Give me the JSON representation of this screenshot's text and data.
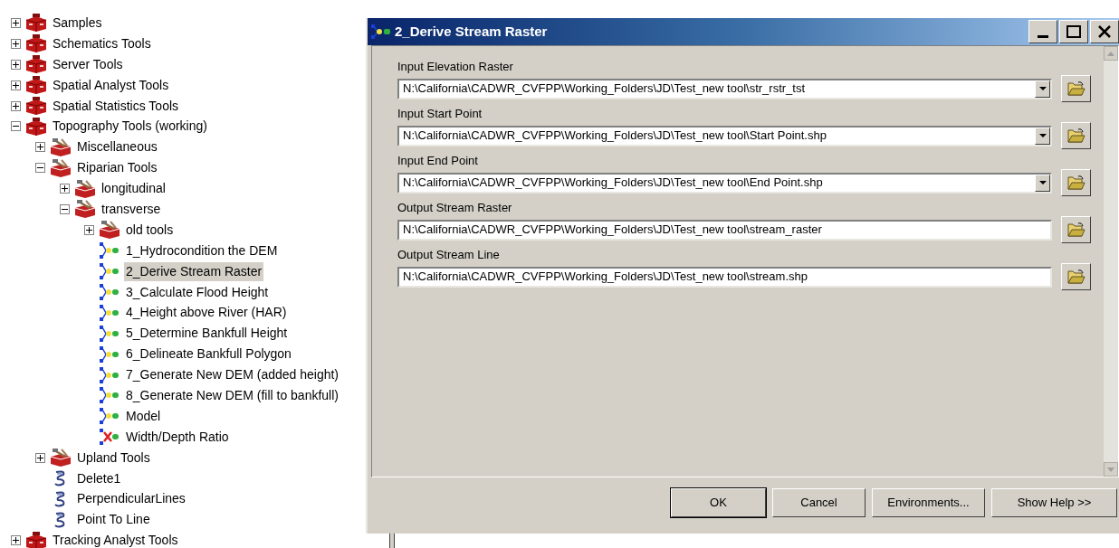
{
  "tree": [
    {
      "label": "Samples",
      "kind": "toolbox",
      "expanded": false,
      "selected": false
    },
    {
      "label": "Schematics Tools",
      "kind": "toolbox",
      "expanded": false,
      "selected": false
    },
    {
      "label": "Server Tools",
      "kind": "toolbox",
      "expanded": false,
      "selected": false
    },
    {
      "label": "Spatial Analyst Tools",
      "kind": "toolbox",
      "expanded": false,
      "selected": false
    },
    {
      "label": "Spatial Statistics Tools",
      "kind": "toolbox",
      "expanded": false,
      "selected": false
    },
    {
      "label": "Topography Tools (working)",
      "kind": "toolbox",
      "expanded": true,
      "selected": false,
      "children": [
        {
          "label": "Miscellaneous",
          "kind": "toolset",
          "expanded": false,
          "selected": false
        },
        {
          "label": "Riparian Tools",
          "kind": "toolset",
          "expanded": true,
          "selected": false,
          "children": [
            {
              "label": "longitudinal",
              "kind": "toolset",
              "expanded": false,
              "selected": false
            },
            {
              "label": "transverse",
              "kind": "toolset",
              "expanded": true,
              "selected": false,
              "children": [
                {
                  "label": "old tools",
                  "kind": "toolset",
                  "expanded": false,
                  "selected": false
                },
                {
                  "label": "1_Hydrocondition the DEM",
                  "kind": "model",
                  "selected": false
                },
                {
                  "label": "2_Derive Stream Raster",
                  "kind": "model",
                  "selected": true
                },
                {
                  "label": "3_Calculate Flood Height",
                  "kind": "model",
                  "selected": false
                },
                {
                  "label": "4_Height above River (HAR)",
                  "kind": "model",
                  "selected": false
                },
                {
                  "label": "5_Determine Bankfull Height",
                  "kind": "model",
                  "selected": false
                },
                {
                  "label": "6_Delineate Bankfull Polygon",
                  "kind": "model",
                  "selected": false
                },
                {
                  "label": "7_Generate New DEM (added height)",
                  "kind": "model",
                  "selected": false
                },
                {
                  "label": "8_Generate New DEM (fill to bankfull)",
                  "kind": "model",
                  "selected": false
                },
                {
                  "label": "Model",
                  "kind": "model",
                  "selected": false
                },
                {
                  "label": "Width/Depth Ratio",
                  "kind": "model_error",
                  "selected": false
                }
              ]
            }
          ]
        },
        {
          "label": "Upland Tools",
          "kind": "toolset",
          "expanded": false,
          "selected": false
        },
        {
          "label": "Delete1",
          "kind": "script",
          "selected": false
        },
        {
          "label": "PerpendicularLines",
          "kind": "script",
          "selected": false
        },
        {
          "label": "Point To Line",
          "kind": "script",
          "selected": false
        }
      ]
    },
    {
      "label": "Tracking Analyst Tools",
      "kind": "toolbox",
      "expanded": false,
      "selected": false
    }
  ],
  "dialog": {
    "title": "2_Derive Stream Raster",
    "parameters": [
      {
        "label": "Input Elevation Raster",
        "kind": "dropdown",
        "value": "N:\\California\\CADWR_CVFPP\\Working_Folders\\JD\\Test_new tool\\str_rstr_tst"
      },
      {
        "label": "Input Start Point",
        "kind": "dropdown",
        "value": "N:\\California\\CADWR_CVFPP\\Working_Folders\\JD\\Test_new tool\\Start Point.shp"
      },
      {
        "label": "Input End Point",
        "kind": "dropdown",
        "value": "N:\\California\\CADWR_CVFPP\\Working_Folders\\JD\\Test_new tool\\End Point.shp"
      },
      {
        "label": "Output Stream Raster",
        "kind": "text",
        "value": "N:\\California\\CADWR_CVFPP\\Working_Folders\\JD\\Test_new tool\\stream_raster"
      },
      {
        "label": "Output Stream Line",
        "kind": "text",
        "value": "N:\\California\\CADWR_CVFPP\\Working_Folders\\JD\\Test_new tool\\stream.shp"
      }
    ],
    "buttons": [
      {
        "label": "OK",
        "default": true
      },
      {
        "label": "Cancel",
        "default": false
      },
      {
        "label": "Environments...",
        "default": false
      },
      {
        "label": "Show Help >>",
        "default": false
      }
    ]
  }
}
